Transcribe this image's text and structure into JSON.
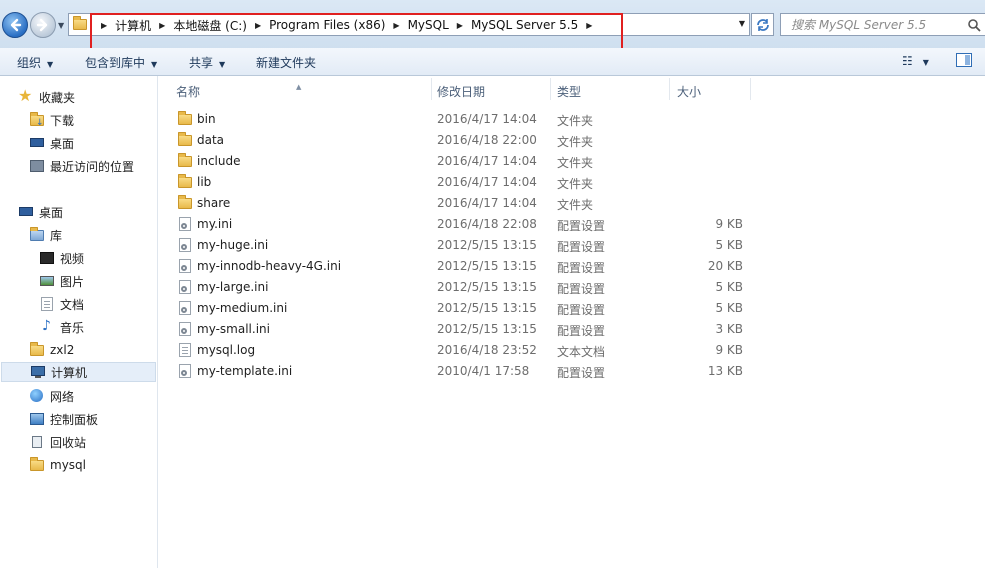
{
  "address_bar": {
    "breadcrumbs": [
      "计算机",
      "本地磁盘 (C:)",
      "Program Files (x86)",
      "MySQL",
      "MySQL Server 5.5"
    ],
    "search_placeholder": "搜索 MySQL Server 5.5"
  },
  "toolbar": {
    "organize": "组织",
    "include_in_library": "包含到库中",
    "share": "共享",
    "new_folder": "新建文件夹"
  },
  "sidebar": {
    "favorites": "收藏夹",
    "favorites_items": [
      "下载",
      "桌面",
      "最近访问的位置"
    ],
    "desktop": "桌面",
    "libraries": "库",
    "library_items": [
      "视频",
      "图片",
      "文档",
      "音乐"
    ],
    "user": "zxl2",
    "computer": "计算机",
    "network": "网络",
    "control_panel": "控制面板",
    "recycle_bin": "回收站",
    "mysql": "mysql"
  },
  "columns": {
    "name": "名称",
    "date": "修改日期",
    "type": "类型",
    "size": "大小"
  },
  "files": [
    {
      "name": "bin",
      "date": "2016/4/17 14:04",
      "type": "文件夹",
      "size": "",
      "icon": "folder-icon"
    },
    {
      "name": "data",
      "date": "2016/4/18 22:00",
      "type": "文件夹",
      "size": "",
      "icon": "folder-icon"
    },
    {
      "name": "include",
      "date": "2016/4/17 14:04",
      "type": "文件夹",
      "size": "",
      "icon": "folder-icon"
    },
    {
      "name": "lib",
      "date": "2016/4/17 14:04",
      "type": "文件夹",
      "size": "",
      "icon": "folder-icon"
    },
    {
      "name": "share",
      "date": "2016/4/17 14:04",
      "type": "文件夹",
      "size": "",
      "icon": "folder-icon"
    },
    {
      "name": "my.ini",
      "date": "2016/4/18 22:08",
      "type": "配置设置",
      "size": "9 KB",
      "icon": "config-file-icon"
    },
    {
      "name": "my-huge.ini",
      "date": "2012/5/15 13:15",
      "type": "配置设置",
      "size": "5 KB",
      "icon": "config-file-icon"
    },
    {
      "name": "my-innodb-heavy-4G.ini",
      "date": "2012/5/15 13:15",
      "type": "配置设置",
      "size": "20 KB",
      "icon": "config-file-icon"
    },
    {
      "name": "my-large.ini",
      "date": "2012/5/15 13:15",
      "type": "配置设置",
      "size": "5 KB",
      "icon": "config-file-icon"
    },
    {
      "name": "my-medium.ini",
      "date": "2012/5/15 13:15",
      "type": "配置设置",
      "size": "5 KB",
      "icon": "config-file-icon"
    },
    {
      "name": "my-small.ini",
      "date": "2012/5/15 13:15",
      "type": "配置设置",
      "size": "3 KB",
      "icon": "config-file-icon"
    },
    {
      "name": "mysql.log",
      "date": "2016/4/18 23:52",
      "type": "文本文档",
      "size": "9 KB",
      "icon": "text-file-icon"
    },
    {
      "name": "my-template.ini",
      "date": "2010/4/1 17:58",
      "type": "配置设置",
      "size": "13 KB",
      "icon": "config-file-icon"
    }
  ],
  "colors": {
    "highlight_box": "#e02020",
    "toolbar_text": "#1e395b",
    "selected_bg": "#e5eef9"
  }
}
